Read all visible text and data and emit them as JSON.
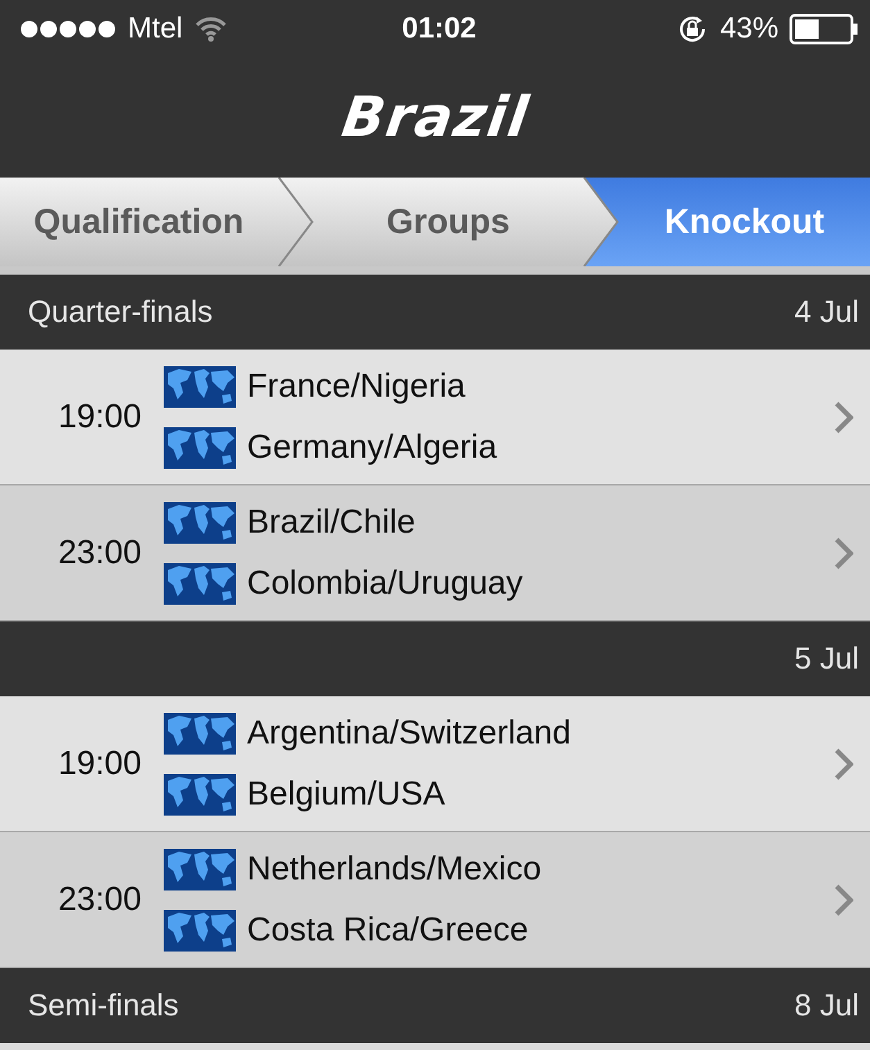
{
  "status_bar": {
    "carrier": "Mtel",
    "time": "01:02",
    "battery": "43%"
  },
  "title": "Brazil",
  "tabs": [
    {
      "label": "Qualification",
      "selected": false
    },
    {
      "label": "Groups",
      "selected": false
    },
    {
      "label": "Knockout",
      "selected": true
    }
  ],
  "sections": [
    {
      "title": "Quarter-finals",
      "date": "4 Jul",
      "matches": [
        {
          "time": "19:00",
          "pairs": [
            "France/Nigeria",
            "Germany/Algeria"
          ]
        },
        {
          "time": "23:00",
          "pairs": [
            "Brazil/Chile",
            "Colombia/Uruguay"
          ]
        }
      ]
    },
    {
      "date": "5 Jul",
      "matches": [
        {
          "time": "19:00",
          "pairs": [
            "Argentina/Switzerland",
            "Belgium/USA"
          ]
        },
        {
          "time": "23:00",
          "pairs": [
            "Netherlands/Mexico",
            "Costa Rica/Greece"
          ]
        }
      ]
    },
    {
      "title": "Semi-finals",
      "date": "8 Jul"
    }
  ]
}
